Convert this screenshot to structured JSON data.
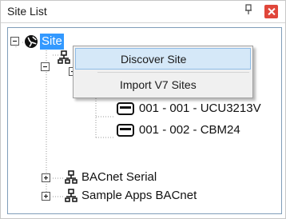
{
  "panel": {
    "title": "Site List",
    "pin_glyph": "ꟸ",
    "pin_icon": "pin-icon",
    "close_icon": "close-icon"
  },
  "tree": {
    "root": {
      "label": "Site",
      "icon": "globe-icon",
      "selected": true
    },
    "children": [
      {
        "label": "001 - 001 - UCU3213V",
        "icon": "device-icon"
      },
      {
        "label": "001 - 002 - CBM24",
        "icon": "device-icon"
      },
      {
        "label": "BACnet Serial",
        "icon": "network-icon"
      },
      {
        "label": "Sample Apps BACnet",
        "icon": "network-icon"
      }
    ]
  },
  "context_menu": {
    "items": [
      {
        "label": "Discover Site",
        "hover": true
      },
      {
        "label": "Import V7 Sites",
        "hover": false
      }
    ]
  },
  "colors": {
    "selection": "#3399ff",
    "menu_hover": "#d5e8f8",
    "close": "#e0463a"
  }
}
